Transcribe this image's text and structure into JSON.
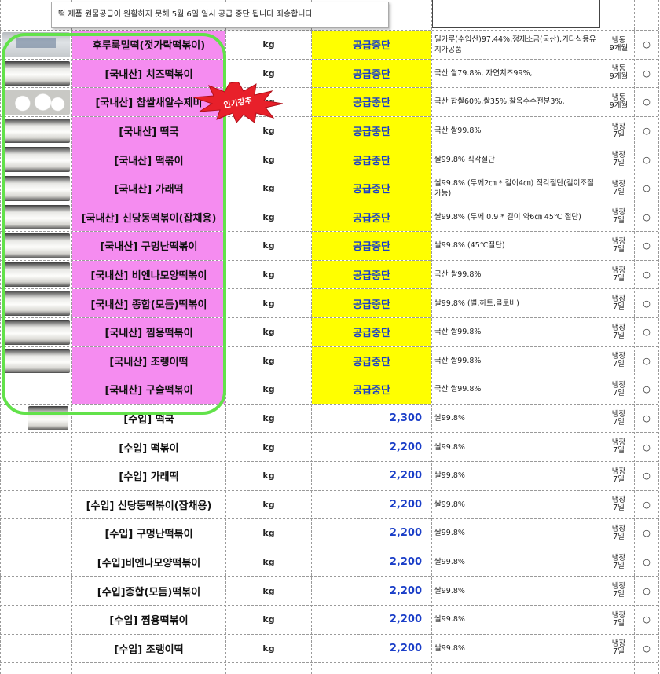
{
  "notice": "떡 제품 원물공급이 원활하지 못해 5월 6일 일시 공급 중단 됩니다 죄송합니다",
  "badge": "인기강추",
  "colors": {
    "pink": "#f58cf0",
    "yellow": "#ffff00",
    "green_outline": "#62e24a",
    "price_blue": "#1a3ec8",
    "badge_red": "#e8202a"
  },
  "rows": [
    {
      "name": "후루룩밀떡(젓가락떡볶이)",
      "unit": "kg",
      "price": "공급중단",
      "desc": "밀가루(수입산)97.44%,정제소금(국산),기타식용유지가공품",
      "storage": "냉동\n9개월",
      "mark": "○",
      "thumb": "bag",
      "stop": true
    },
    {
      "name": "[국내산] 치즈떡볶이",
      "unit": "kg",
      "price": "공급중단",
      "desc": "국산 쌀79.8%, 자연치즈99%,",
      "storage": "냉동\n9개월",
      "mark": "○",
      "thumb": "stick",
      "stop": true
    },
    {
      "name": "[국내산] 찹쌀새알수제비",
      "unit": "kg",
      "price": "공급중단",
      "desc": "국산 찹쌀60%,쌀35%,찰옥수수전분3%,",
      "storage": "냉동\n9개월",
      "mark": "○",
      "thumb": "rice",
      "stop": true
    },
    {
      "name": "[국내산] 떡국",
      "unit": "kg",
      "price": "공급중단",
      "desc": "국산 쌀99.8%",
      "storage": "냉장\n7일",
      "mark": "○",
      "thumb": "stick",
      "stop": true
    },
    {
      "name": "[국내산] 떡볶이",
      "unit": "kg",
      "price": "공급중단",
      "desc": "쌀99.8%  직각절단",
      "storage": "냉장\n7일",
      "mark": "○",
      "thumb": "stick",
      "stop": true
    },
    {
      "name": "[국내산] 가래떡",
      "unit": "kg",
      "price": "공급중단",
      "desc": "쌀99.8% (두께2㎝ * 길이4㎝) 직각절단(길이조절 가능)",
      "storage": "냉장\n7일",
      "mark": "○",
      "thumb": "stick",
      "stop": true
    },
    {
      "name": "[국내산] 신당동떡볶이(잡채용)",
      "unit": "kg",
      "price": "공급중단",
      "desc": "쌀99.8% (두께 0.9 * 길이 약6㎝ 45℃ 절단)",
      "storage": "냉장\n7일",
      "mark": "○",
      "thumb": "stick",
      "stop": true
    },
    {
      "name": "[국내산] 구멍난떡볶이",
      "unit": "kg",
      "price": "공급중단",
      "desc": "쌀99.8% (45℃절단)",
      "storage": "냉장\n7일",
      "mark": "○",
      "thumb": "stick",
      "stop": true
    },
    {
      "name": "[국내산] 비엔나모양떡볶이",
      "unit": "kg",
      "price": "공급중단",
      "desc": "국산 쌀99.8%",
      "storage": "냉장\n7일",
      "mark": "○",
      "thumb": "stick",
      "stop": true
    },
    {
      "name": "[국내산] 종합(모듬)떡볶이",
      "unit": "kg",
      "price": "공급중단",
      "desc": "쌀99.8%  (별,하트,클로버)",
      "storage": "냉장\n7일",
      "mark": "○",
      "thumb": "stick",
      "stop": true
    },
    {
      "name": "[국내산] 찜용떡볶이",
      "unit": "kg",
      "price": "공급중단",
      "desc": "국산 쌀99.8%",
      "storage": "냉장\n7일",
      "mark": "○",
      "thumb": "stick",
      "stop": true
    },
    {
      "name": "[국내산] 조랭이떡",
      "unit": "kg",
      "price": "공급중단",
      "desc": "국산 쌀99.8%",
      "storage": "냉장\n7일",
      "mark": "○",
      "thumb": "stick",
      "stop": true
    },
    {
      "name": "[국내산] 구슬떡볶이",
      "unit": "kg",
      "price": "공급중단",
      "desc": "국산 쌀99.8%",
      "storage": "냉장\n7일",
      "mark": "○",
      "thumb": "none",
      "stop": true
    },
    {
      "name": "[수입] 떡국",
      "unit": "kg",
      "price": "2,300",
      "desc": "쌀99.8%",
      "storage": "냉장\n7일",
      "mark": "○",
      "thumb": "small",
      "stop": false
    },
    {
      "name": "[수입] 떡볶이",
      "unit": "kg",
      "price": "2,200",
      "desc": "쌀99.8%",
      "storage": "냉장\n7일",
      "mark": "○",
      "thumb": "none",
      "stop": false
    },
    {
      "name": "[수입] 가래떡",
      "unit": "kg",
      "price": "2,200",
      "desc": "쌀99.8%",
      "storage": "냉장\n7일",
      "mark": "○",
      "thumb": "none",
      "stop": false
    },
    {
      "name": "[수입] 신당동떡볶이(잡채용)",
      "unit": "kg",
      "price": "2,200",
      "desc": "쌀99.8%",
      "storage": "냉장\n7일",
      "mark": "○",
      "thumb": "none",
      "stop": false
    },
    {
      "name": "[수입] 구멍난떡볶이",
      "unit": "kg",
      "price": "2,200",
      "desc": "쌀99.8%",
      "storage": "냉장\n7일",
      "mark": "○",
      "thumb": "none",
      "stop": false
    },
    {
      "name": "[수입]비엔나모양떡볶이",
      "unit": "kg",
      "price": "2,200",
      "desc": "쌀99.8%",
      "storage": "냉장\n7일",
      "mark": "○",
      "thumb": "none",
      "stop": false
    },
    {
      "name": "[수입]종합(모듬)떡볶이",
      "unit": "kg",
      "price": "2,200",
      "desc": "쌀99.8%",
      "storage": "냉장\n7일",
      "mark": "○",
      "thumb": "none",
      "stop": false
    },
    {
      "name": "[수입] 찜용떡볶이",
      "unit": "kg",
      "price": "2,200",
      "desc": "쌀99.8%",
      "storage": "냉장\n7일",
      "mark": "○",
      "thumb": "none",
      "stop": false
    },
    {
      "name": "[수입] 조랭이떡",
      "unit": "kg",
      "price": "2,200",
      "desc": "쌀99.8%",
      "storage": "냉장\n7일",
      "mark": "○",
      "thumb": "none",
      "stop": false
    }
  ]
}
